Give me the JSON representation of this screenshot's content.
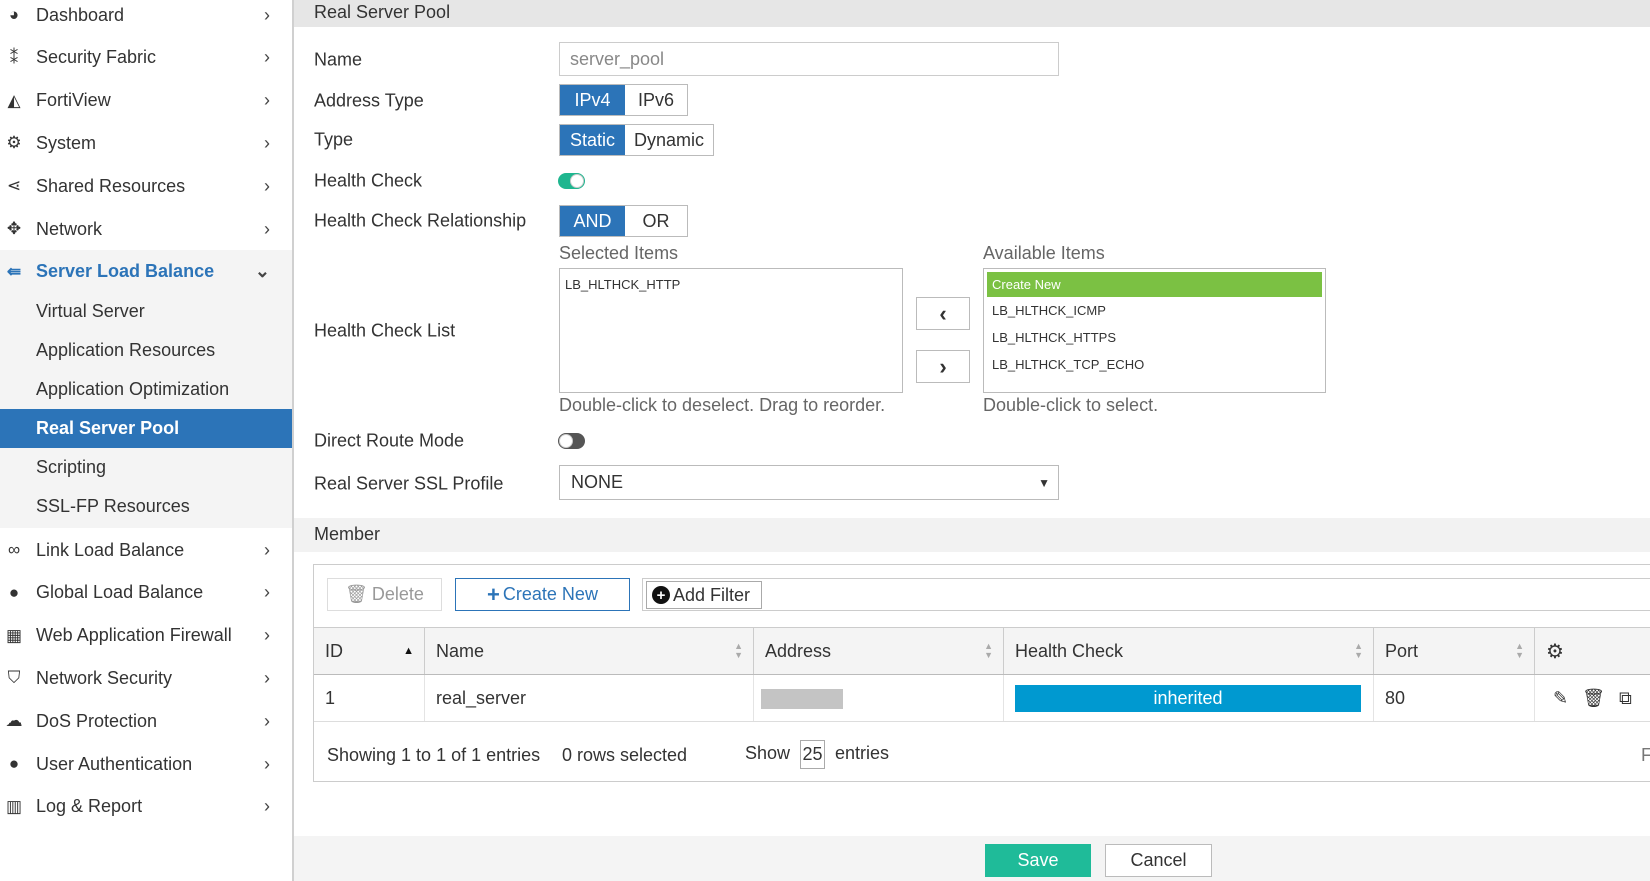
{
  "sidebar": {
    "items": [
      {
        "label": "Dashboard",
        "icon": "dashboard-icon"
      },
      {
        "label": "Security Fabric",
        "icon": "security-fabric-icon"
      },
      {
        "label": "FortiView",
        "icon": "area-chart-icon"
      },
      {
        "label": "System",
        "icon": "gear-icon"
      },
      {
        "label": "Shared Resources",
        "icon": "share-icon"
      },
      {
        "label": "Network",
        "icon": "move-arrows-icon"
      },
      {
        "label": "Server Load Balance",
        "icon": "load-balance-icon"
      }
    ],
    "sub_items": [
      "Virtual Server",
      "Application Resources",
      "Application Optimization",
      "Real Server Pool",
      "Scripting",
      "SSL-FP Resources"
    ],
    "items_after": [
      {
        "label": "Link Load Balance",
        "icon": "link-icon"
      },
      {
        "label": "Global Load Balance",
        "icon": "globe-icon"
      },
      {
        "label": "Web Application Firewall",
        "icon": "firewall-icon"
      },
      {
        "label": "Network Security",
        "icon": "shield-icon"
      },
      {
        "label": "DoS Protection",
        "icon": "cloud-icon"
      },
      {
        "label": "User Authentication",
        "icon": "user-icon"
      },
      {
        "label": "Log & Report",
        "icon": "bar-chart-icon"
      }
    ]
  },
  "header": {
    "title": "Real Server Pool"
  },
  "form": {
    "name_label": "Name",
    "name_value": "server_pool",
    "address_type_label": "Address Type",
    "address_type_options": [
      "IPv4",
      "IPv6"
    ],
    "type_label": "Type",
    "type_options": [
      "Static",
      "Dynamic"
    ],
    "health_check_label": "Health Check",
    "relationship_label": "Health Check Relationship",
    "relationship_options": [
      "AND",
      "OR"
    ],
    "hc_list_label": "Health Check List",
    "selected_title": "Selected Items",
    "selected_items": [
      "LB_HLTHCK_HTTP"
    ],
    "available_title": "Available Items",
    "available_items": [
      "Create New",
      "LB_HLTHCK_ICMP",
      "LB_HLTHCK_HTTPS",
      "LB_HLTHCK_TCP_ECHO"
    ],
    "selected_hint": "Double-click to deselect. Drag to reorder.",
    "available_hint": "Double-click to select.",
    "direct_route_label": "Direct Route Mode",
    "ssl_label": "Real Server SSL Profile",
    "ssl_value": "NONE"
  },
  "member": {
    "title": "Member",
    "delete_label": "Delete",
    "create_label": "Create New",
    "filter_label": "Add Filter",
    "columns": [
      "ID",
      "Name",
      "Address",
      "Health Check",
      "Port"
    ],
    "rows": [
      {
        "id": "1",
        "name": "real_server",
        "health": "inherited",
        "port": "80"
      }
    ],
    "showing": "Showing 1 to 1 of 1 entries",
    "selected": "0 rows selected",
    "show": "Show",
    "page_size": "25",
    "entries": "entries",
    "edge": "F"
  },
  "footer": {
    "save": "Save",
    "cancel": "Cancel"
  },
  "colors": {
    "accent": "#2c74b8",
    "toggle_on": "#1fb68f",
    "create_new": "#7bc143",
    "health": "#0099d0",
    "save": "#1fbb99"
  }
}
